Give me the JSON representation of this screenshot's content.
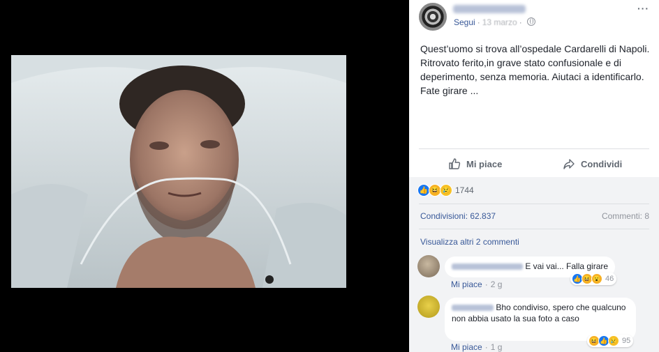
{
  "post": {
    "meta": {
      "follow_label": "Segui",
      "date": "13 marzo"
    },
    "text": "Quest’uomo si trova all’ospedale Cardarelli di Napoli. Ritrovato ferito,in grave stato confusionale e di deperimento, senza memoria. Aiutaci a identificarlo. Fate girare ...",
    "more_label": "···"
  },
  "actions": {
    "like_label": "Mi piace",
    "share_label": "Condividi"
  },
  "stats": {
    "reaction_count": "1744",
    "shares": "Condivisioni: 62.837",
    "comments": "Commenti: 8",
    "view_more": "Visualizza altri 2 commenti"
  },
  "comments": [
    {
      "text": "E vai vai... Falla girare",
      "like_label": "Mi piace",
      "age": "2 g",
      "reaction_count": "46"
    },
    {
      "text": "Bho condiviso, spero che qualcuno non abbia usato la sua foto a caso",
      "like_label": "Mi piace",
      "age": "1 g",
      "reaction_count": "95"
    }
  ],
  "colors": {
    "link": "#385898",
    "muted": "#90949c",
    "like_blue": "#1877f2",
    "panel_gray": "#f2f3f5"
  }
}
